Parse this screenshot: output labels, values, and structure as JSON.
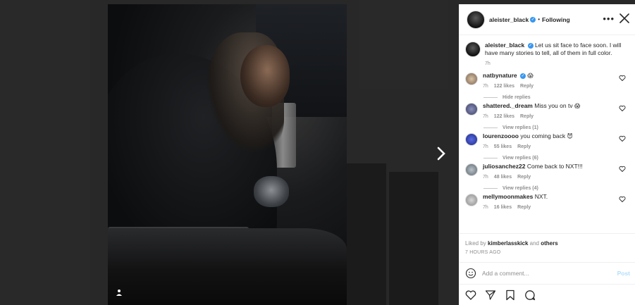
{
  "header": {
    "username": "aleister_black",
    "separator": "•",
    "follow_state": "Following",
    "more_label": "•••"
  },
  "caption": {
    "username": "aleister_black",
    "text": "Let us sit face to face soon. I will have many stories to tell, all of them in full color.",
    "time": "7h"
  },
  "comments": [
    {
      "username": "natbynature",
      "text": "",
      "emoji": "😱",
      "time": "7h",
      "likes": "122 likes",
      "reply": "Reply",
      "replies_toggle": "Hide replies",
      "verified": true
    },
    {
      "username": "shattered._dream",
      "text": "Miss you on tv",
      "emoji": "😱",
      "time": "7h",
      "likes": "122 likes",
      "reply": "Reply",
      "replies_toggle": "View replies (1)"
    },
    {
      "username": "lourenzoooo",
      "text": "you coming back",
      "emoji": "😈",
      "time": "7h",
      "likes": "55 likes",
      "reply": "Reply",
      "replies_toggle": "View replies (6)"
    },
    {
      "username": "juliosanchez22",
      "text": "Come back to NXT!!!",
      "emoji": "",
      "time": "7h",
      "likes": "48 likes",
      "reply": "Reply",
      "replies_toggle": "View replies (4)"
    },
    {
      "username": "mellymoonmakes",
      "text": "NXT.",
      "emoji": "",
      "time": "7h",
      "likes": "16 likes",
      "reply": "Reply",
      "replies_toggle": ""
    }
  ],
  "likes": {
    "prefix": "Liked by",
    "user": "kimberlasskick",
    "middle": "and",
    "others": "others"
  },
  "time_ago": "7 Hours Ago",
  "composer": {
    "placeholder": "Add a comment...",
    "post_label": "Post"
  },
  "icons": {
    "next": "chevron-right-icon",
    "close": "close-icon",
    "heart": "heart-icon",
    "share": "paper-plane-icon",
    "save": "bookmark-icon",
    "comment": "comment-bubble-icon",
    "emoji": "smiley-icon",
    "tag": "user-tag-icon"
  },
  "colors": {
    "verified": "#3897f0",
    "post_disabled": "#b2dffc",
    "meta_text": "#8e8e8e"
  }
}
